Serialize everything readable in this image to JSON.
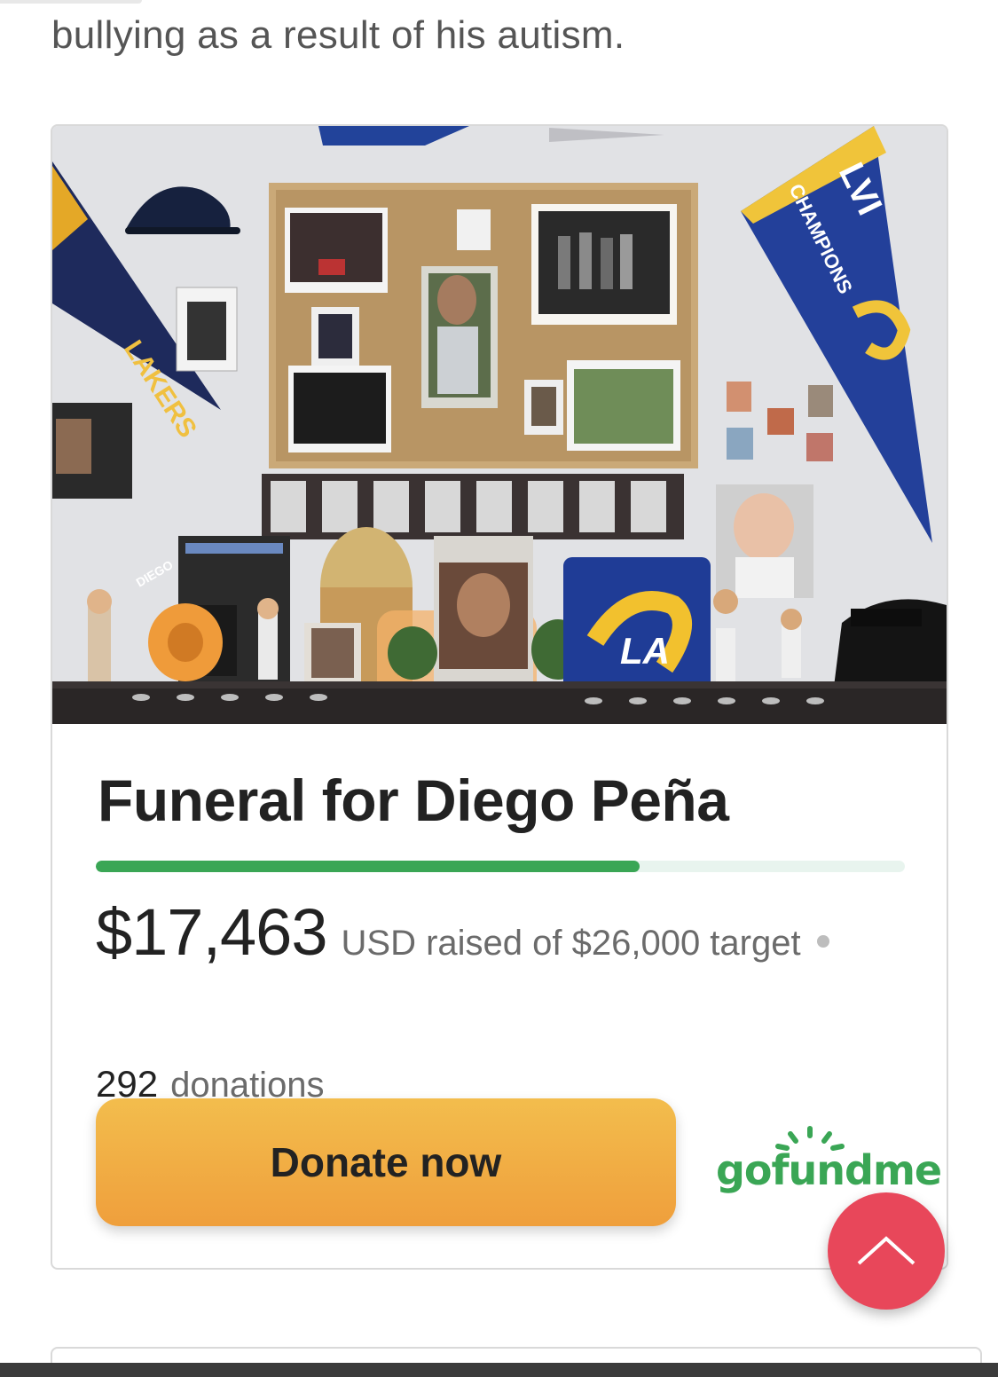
{
  "article": {
    "intro_text": "bullying as a result of his autism."
  },
  "fundraiser": {
    "title": "Funeral for Diego Peña",
    "progress_fraction": 0.672,
    "raised_amount": "$17,463",
    "raised_description": "USD raised of $26,000 target",
    "donation_count": "292",
    "donation_label": "donations",
    "donate_button_label": "Donate now",
    "brand_logo_text": "gofundme",
    "colors": {
      "progress": "#3aa655",
      "button": "#f2b045",
      "brand": "#3aa655",
      "scroll_top_button": "#e8475a"
    }
  },
  "photo": {
    "pennant_left_text": "LAKERS",
    "pennant_right_text": "CHAMPIONS",
    "pennant_right_number": "LVI",
    "sign_text": "DIEGO",
    "ram_logo_text": "LA"
  },
  "scroll_top": {
    "icon": "chevron-up-icon"
  }
}
